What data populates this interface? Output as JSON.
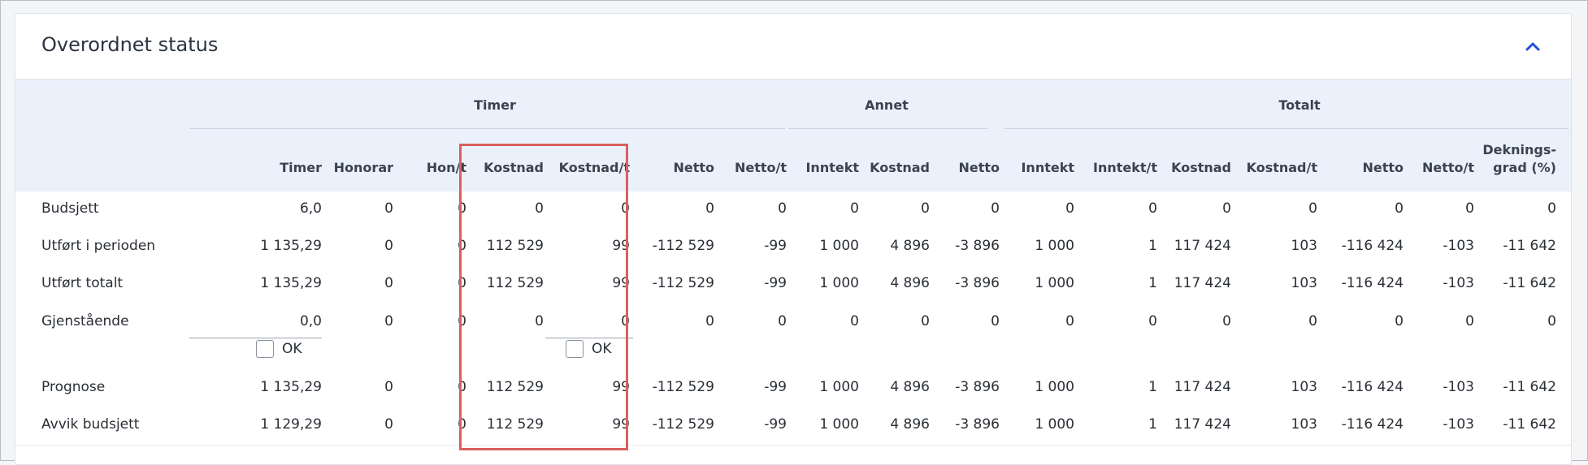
{
  "panel": {
    "title": "Overordnet status"
  },
  "groups": {
    "timer": "Timer",
    "annet": "Annet",
    "totalt": "Totalt"
  },
  "columns": [
    "Timer",
    "Honorar",
    "Hon/t",
    "Kostnad",
    "Kostnad/t",
    "Netto",
    "Netto/t",
    "Inntekt",
    "Kostnad",
    "Netto",
    "Inntekt",
    "Inntekt/t",
    "Kostnad",
    "Kostnad/t",
    "Netto",
    "Netto/t",
    "Deknings-",
    "grad (%)"
  ],
  "rows": [
    {
      "label": "Budsjett",
      "values": [
        "6,0",
        "0",
        "0",
        "0",
        "0",
        "0",
        "0",
        "0",
        "0",
        "0",
        "0",
        "0",
        "0",
        "0",
        "0",
        "0",
        "0"
      ]
    },
    {
      "label": "Utført i perioden",
      "values": [
        "1 135,29",
        "0",
        "0",
        "112 529",
        "99",
        "-112 529",
        "-99",
        "1 000",
        "4 896",
        "-3 896",
        "1 000",
        "1",
        "117 424",
        "103",
        "-116 424",
        "-103",
        "-11 642"
      ]
    },
    {
      "label": "Utført totalt",
      "values": [
        "1 135,29",
        "0",
        "0",
        "112 529",
        "99",
        "-112 529",
        "-99",
        "1 000",
        "4 896",
        "-3 896",
        "1 000",
        "1",
        "117 424",
        "103",
        "-116 424",
        "-103",
        "-11 642"
      ]
    },
    {
      "label": "Gjenstående",
      "values": [
        "0,0",
        "0",
        "0",
        "0",
        "0",
        "0",
        "0",
        "0",
        "0",
        "0",
        "0",
        "0",
        "0",
        "0",
        "0",
        "0",
        "0"
      ],
      "ok_label": "OK"
    },
    {
      "label": "Prognose",
      "values": [
        "1 135,29",
        "0",
        "0",
        "112 529",
        "99",
        "-112 529",
        "-99",
        "1 000",
        "4 896",
        "-3 896",
        "1 000",
        "1",
        "117 424",
        "103",
        "-116 424",
        "-103",
        "-11 642"
      ]
    },
    {
      "label": "Avvik budsjett",
      "values": [
        "1 129,29",
        "0",
        "0",
        "112 529",
        "99",
        "-112 529",
        "-99",
        "1 000",
        "4 896",
        "-3 896",
        "1 000",
        "1",
        "117 424",
        "103",
        "-116 424",
        "-103",
        "-11 642"
      ]
    }
  ],
  "colors": {
    "highlight": "#d9605f",
    "accent": "#1f4fd6"
  },
  "icons": {
    "collapse": "chevron-up-icon"
  }
}
